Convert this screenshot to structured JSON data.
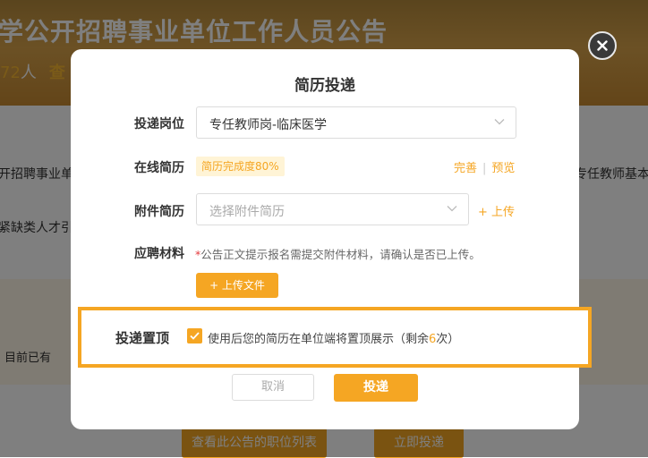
{
  "background": {
    "title": "学公开招聘事业单位工作人员公告",
    "count_num": "72",
    "count_unit": "人",
    "count_view": "查",
    "row1_left": "开招聘事业单位",
    "row1_right": "专任教师基本",
    "row2_left": "紧缺类人才引",
    "already": "目前已有",
    "btn_job_list": "查看此公告的职位列表",
    "btn_apply": "立即投递"
  },
  "modal": {
    "title": "简历投递",
    "position": {
      "label": "投递岗位",
      "value": "专任教师岗-临床医学"
    },
    "online_resume": {
      "label": "在线简历",
      "badge": "简历完成度80%",
      "complete_link": "完善",
      "preview_link": "预览"
    },
    "attachment": {
      "label": "附件简历",
      "placeholder": "选择附件简历",
      "upload_link": "+ 上传"
    },
    "materials": {
      "label": "应聘材料",
      "hint": "公告正文提示报名需提交附件材料，请确认是否已上传。",
      "upload_button": "+ 上传文件"
    },
    "pin": {
      "label": "投递置顶",
      "checked": true,
      "desc_prefix": "使用后您的简历在单位端将置顶展示（剩余",
      "remaining": "6",
      "desc_suffix": "次）"
    },
    "cancel_button": "取消",
    "submit_button": "投递"
  },
  "colors": {
    "accent": "#f5a623",
    "overlay": "rgba(0,0,0,0.5)",
    "highlight_border": "#f5a623"
  },
  "icons": {
    "close": "close-icon",
    "chevron": "chevron-down-icon",
    "check": "check-icon"
  }
}
